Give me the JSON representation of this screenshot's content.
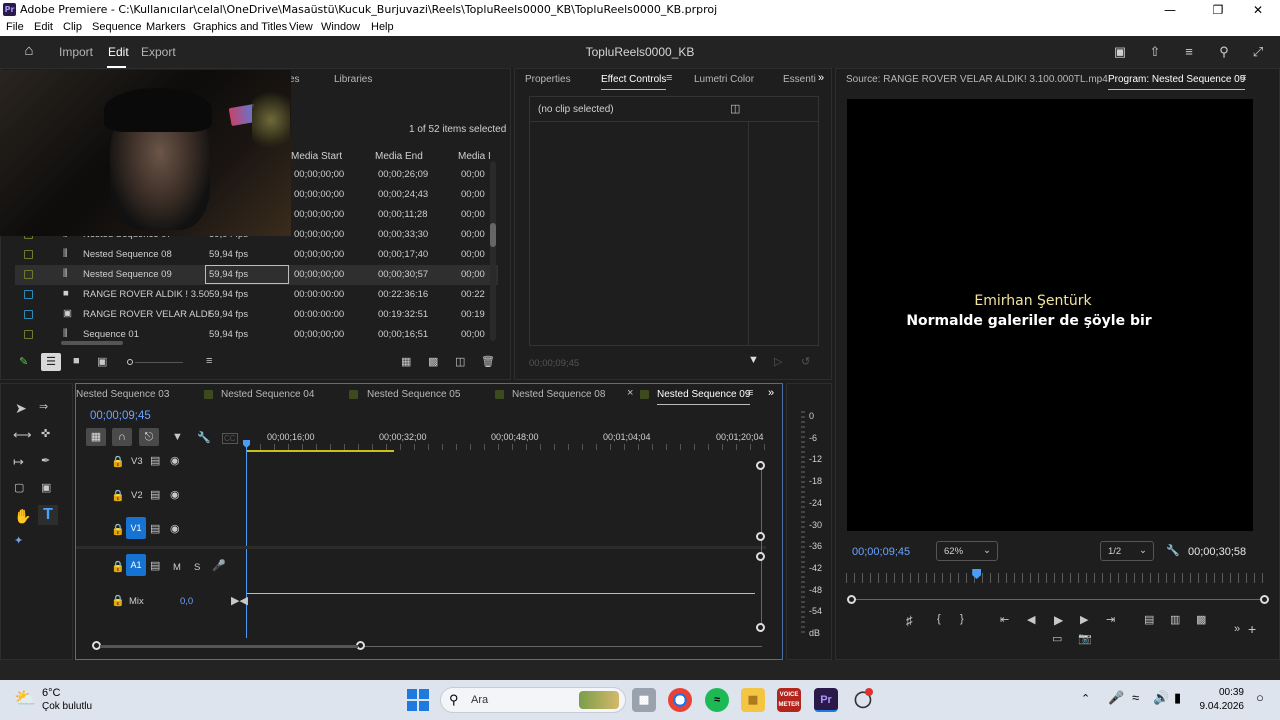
{
  "titlebar": {
    "title": "Adobe Premiere - C:\\Kullanıcılar\\celal\\OneDrive\\Masaüstü\\Kucuk_Burjuvazi\\Reels\\TopluReels0000_KB\\TopluReels0000_KB.prproj",
    "logo": "Pr"
  },
  "menu": [
    "File",
    "Edit",
    "Clip",
    "Sequence",
    "Markers",
    "Graphics and Titles",
    "View",
    "Window",
    "Help"
  ],
  "header": {
    "import": "Import",
    "edit": "Edit",
    "export": "Export",
    "project_name": "TopluReels0000_KB"
  },
  "project_panel": {
    "tabs": [
      "es",
      "Libraries"
    ],
    "selection_info": "1 of 52 items selected",
    "columns": [
      "Media Start",
      "Media End",
      "Media I"
    ],
    "rows": [
      {
        "name": "",
        "fps": "",
        "start": "00;00;00;00",
        "end": "00;00;26;09",
        "dur": "00;00",
        "color": "#6a7b2b",
        "icon": "seq"
      },
      {
        "name": "",
        "fps": "",
        "start": "00;00;00;00",
        "end": "00;00;24;43",
        "dur": "00;00",
        "color": "#6a7b2b",
        "icon": "seq"
      },
      {
        "name": "",
        "fps": "",
        "start": "00;00;00;00",
        "end": "00;00;11;28",
        "dur": "00;00",
        "color": "#6a7b2b",
        "icon": "seq"
      },
      {
        "name": "Nested Sequence 07",
        "fps": "59,94 fps",
        "start": "00;00;00;00",
        "end": "00;00;33;30",
        "dur": "00;00",
        "color": "#6a7b2b",
        "icon": "seq"
      },
      {
        "name": "Nested Sequence 08",
        "fps": "59,94 fps",
        "start": "00;00;00;00",
        "end": "00;00;17;40",
        "dur": "00;00",
        "color": "#6a7b2b",
        "icon": "seq"
      },
      {
        "name": "Nested Sequence 09",
        "fps": "59,94 fps",
        "start": "00;00;00;00",
        "end": "00;00;30;57",
        "dur": "00;00",
        "color": "#6a7b2b",
        "icon": "seq"
      },
      {
        "name": "RANGE ROVER ALDIK ! 3.50",
        "fps": "59,94 fps",
        "start": "00:00:00:00",
        "end": "00:22:36:16",
        "dur": "00:22",
        "color": "#2a8bb5",
        "icon": "file"
      },
      {
        "name": "RANGE ROVER VELAR ALDI",
        "fps": "59,94 fps",
        "start": "00:00:00:00",
        "end": "00:19:32:51",
        "dur": "00:19",
        "color": "#2a8bb5",
        "icon": "video"
      },
      {
        "name": "Sequence 01",
        "fps": "59,94 fps",
        "start": "00;00;00;00",
        "end": "00;00;16;51",
        "dur": "00;00",
        "color": "#6a7b2b",
        "icon": "seq"
      }
    ]
  },
  "effects_panel": {
    "tabs": [
      "Properties",
      "Effect Controls",
      "Lumetri Color",
      "Essenti"
    ],
    "no_clip": "(no clip selected)",
    "timecode": "00;00;09;45"
  },
  "program_panel": {
    "source_tab": "Source: RANGE ROVER VELAR ALDIK! 3.100.000TL.mp4",
    "program_tab": "Program: Nested Sequence 09",
    "caption_name": "Emirhan Şentürk",
    "caption_text": "Normalde galeriler de şöyle bir",
    "current_time": "00;00;09;45",
    "zoom": "62%",
    "resolution": "1/2",
    "duration": "00;00;30;58",
    "playhead_fraction": 0.31
  },
  "timeline": {
    "tabs": [
      "Nested Sequence 03",
      "Nested Sequence 04",
      "Nested Sequence 05",
      "Nested Sequence 08",
      "Nested Sequence 09"
    ],
    "timecode": "00;00;09;45",
    "ruler": [
      "00;00;16;00",
      "00;00;32;00",
      "00;00;48;00",
      "00;01;04;04",
      "00;01;20;04"
    ],
    "tracks": [
      "V3",
      "V2",
      "V1",
      "A1"
    ],
    "mix_label": "Mix",
    "mix_value": "0,0",
    "m_label": "M",
    "s_label": "S",
    "cc_label": "CC"
  },
  "meter": [
    "0",
    "-6",
    "-12",
    "-18",
    "-24",
    "-30",
    "-36",
    "-42",
    "-48",
    "-54",
    "dB"
  ],
  "taskbar": {
    "weather_temp": "6°C",
    "weather_desc": "Çok bulutlu",
    "search": "Ara",
    "time": "00:39",
    "date": "9.04.2026",
    "voice_label": "VOICE METER",
    "pr_label": "Pr"
  },
  "colors": {
    "accent_blue": "#1673d1",
    "timecode_blue": "#6aa3ff"
  }
}
